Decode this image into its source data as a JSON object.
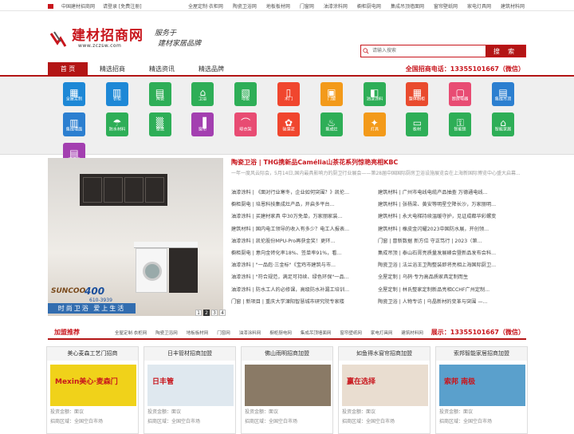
{
  "topbar": {
    "site_name": "中国建材招商网",
    "auth": "请登录 [免费注册]",
    "links": [
      "全屋定制·衣柜网",
      "陶瓷卫浴网",
      "地板板材网",
      "门窗网",
      "油漆涂料网",
      "橱柜厨电网",
      "集成吊顶墙面网",
      "窗帘壁纸网",
      "家电灯具网",
      "建筑材料网"
    ]
  },
  "header": {
    "logo_title": "建材招商网",
    "logo_url": "www.zczsw.com",
    "slogan_line1": "服务于",
    "slogan_line2": "建材家居品牌",
    "search_placeholder": "请输入搜索",
    "search_button": "搜 索"
  },
  "nav": {
    "items": [
      "首 页",
      "精选招商",
      "精选资讯",
      "精选品牌"
    ],
    "phone": "全国招商电话：13355101667（微信）"
  },
  "icons": [
    {
      "label": "全屋定制",
      "color": "#1e88d6",
      "glyph": "▦"
    },
    {
      "label": "衣柜",
      "color": "#1e88d6",
      "glyph": "▥"
    },
    {
      "label": "陶瓷",
      "color": "#2eae57",
      "glyph": "▤"
    },
    {
      "label": "卫浴",
      "color": "#2eae57",
      "glyph": "⌂"
    },
    {
      "label": "地板",
      "color": "#2eae57",
      "glyph": "▧"
    },
    {
      "label": "木门",
      "color": "#f0462e",
      "glyph": "▯"
    },
    {
      "label": "门窗",
      "color": "#f39a1a",
      "glyph": "▣"
    },
    {
      "label": "油漆涂料",
      "color": "#2eae57",
      "glyph": "◧"
    },
    {
      "label": "整体橱柜",
      "color": "#e94b2e",
      "glyph": "▦"
    },
    {
      "label": "厨房电器",
      "color": "#e84c73",
      "glyph": "▢"
    },
    {
      "label": "集成吊顶",
      "color": "#2c7fd0",
      "glyph": "▤"
    },
    {
      "label": "集成墙面",
      "color": "#2c7fd0",
      "glyph": "▥"
    },
    {
      "label": "防水材料",
      "color": "#2eae57",
      "glyph": "☂"
    },
    {
      "label": "壁纸",
      "color": "#2eae57",
      "glyph": "▒"
    },
    {
      "label": "窗帘",
      "color": "#a33fb0",
      "glyph": "▐"
    },
    {
      "label": "晾衣架",
      "color": "#e84c73",
      "glyph": "⌒"
    },
    {
      "label": "硅藻泥",
      "color": "#f0462e",
      "glyph": "✿"
    },
    {
      "label": "集成灶",
      "color": "#2eae57",
      "glyph": "♨"
    },
    {
      "label": "灯具",
      "color": "#f39a1a",
      "glyph": "✦"
    },
    {
      "label": "板材",
      "color": "#2eae57",
      "glyph": "▭"
    },
    {
      "label": "智能家居",
      "color": "#2c7fd0",
      "glyph": "⌂"
    },
    {
      "label": "净水机",
      "color": "#2c7fd0",
      "glyph": "◔"
    }
  ],
  "icons_row2_extra": [
    {
      "label": "智能锁",
      "color": "#2eae57",
      "glyph": "⚿"
    },
    {
      "label": "智能家居",
      "color": "#2eae57",
      "glyph": "⌂"
    },
    {
      "label": "瓷砖胶",
      "color": "#a33fb0",
      "glyph": "▤"
    }
  ],
  "banner": {
    "brand": "SUNCOO",
    "number": "400",
    "phone": "610-3939",
    "slogan": "时尚卫浴 爱上生活",
    "pages": [
      "1",
      "2",
      "3",
      "4"
    ],
    "active_page": "2"
  },
  "headline": "陶瓷卫浴 | THG携新品Camélia山茶花系列惊艳亮相KBC",
  "summary": "一年一度风云际会，5月14日,国内最具影响力的厨卫行业展会——第28届中国国际厨房卫浴设施展览会在上海新国际博览中心盛大启幕...",
  "news_left": [
    "油漆涂料 | 《面对行业寒冬，企业如何突围？》凯伦...",
    "橱柜厨电 | 培恩科技集成灶产品，开启多平台...",
    "油漆涂料 | 买建材家具 中30万免单，万家丽家装...",
    "建筑材料 | 国内电工领导的收入有多少？电工人报表...",
    "油漆涂料 | 凯伦股份MPU-Pro再获金奖！更环...",
    "橱柜厨电 | 意向金砖化率18%、签单率91%，看...",
    "油漆涂料 | \"一品彪·三金标\"《宝鸡市建筑与市...",
    "油漆涂料 | \"符合规范，满足可持续、绿色环保\"一品...",
    "油漆涂料 | 防水工人的必修课，高级防水补漏工培训...",
    "门窗 | 新项目 | 重庆大学溧阳智慧城市研究院专家楼"
  ],
  "news_right": [
    "建筑材料 | 广州市电线电缆产品抽查 万德通电线...",
    "建筑材料 | 张杨梁、黄安等明星空降长沙，万家丽明...",
    "建筑材料 | 永大电梯持续温暖守护，见证成都华彩螺变",
    "建筑材料 | 橡皮金闪耀2023中国防水展，开创领...",
    "门窗 | 冒新数据 新方位 守正笃行 | 2023（第...",
    "集成吊顶 | 泰山石膏亮质量发展峰会暨新品发布会科...",
    "陶瓷卫浴 | 法兰浴王卫陶整装即将亮相上海国际厨卫...",
    "全屋定制 | 乌鸫·专为高品质家具定制而生",
    "全屋定制 | 林氏整家定制新品亮相CCHF广州定制...",
    "陶瓷卫浴 | 人物专访 | 乌晶新材的变革与突围 —..."
  ],
  "recommend": {
    "title": "加盟推荐",
    "links": [
      "全屋定制·衣柜网",
      "陶瓷卫浴网",
      "地板板材网",
      "门窗网",
      "油漆涂料网",
      "橱柜厨电网",
      "集成吊顶墙面网",
      "窗帘壁纸网",
      "家电灯具网",
      "建筑材料网"
    ],
    "phone": "展示：13355101667（微信）"
  },
  "cards": [
    {
      "title": "美心麦森工艺门招商",
      "invest": "投资金额：面议",
      "area": "招商区域：全国空白市场",
      "img_text": "Mexin美心·麦森门",
      "img_color": "#f0d21a"
    },
    {
      "title": "日丰管材招商加盟",
      "invest": "投资金额：面议",
      "area": "招商区域：全国空白市场",
      "img_text": "日丰管",
      "img_color": "#dfe8ef"
    },
    {
      "title": "佛山雨明招商加盟",
      "invest": "投资金额：面议",
      "area": "招商区域：全国空白市场",
      "img_text": "",
      "img_color": "#8a7a66"
    },
    {
      "title": "如鱼得水窗帘招商加盟",
      "invest": "投资金额：面议",
      "area": "招商区域：全国空白市场",
      "img_text": "赢在选择",
      "img_color": "#e9ddd0"
    },
    {
      "title": "索邦智能家居招商加盟",
      "invest": "投资金额：面议",
      "area": "招商区域：全国空白市场",
      "img_text": "索邦 南极",
      "img_color": "#5aa0cc"
    }
  ]
}
